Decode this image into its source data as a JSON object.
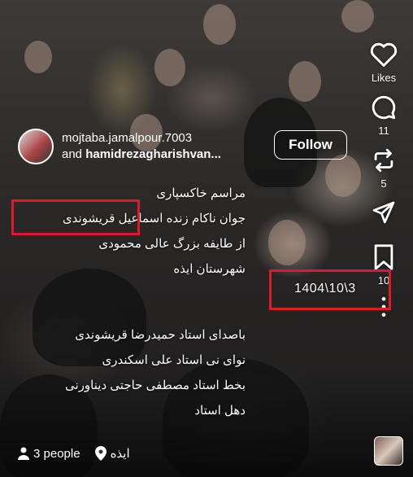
{
  "post": {
    "author1": "mojtaba.jamalpour.7003",
    "and_label": "and",
    "author2": "hamidrezagharishvan...",
    "follow_label": "Follow",
    "caption_lines": [
      "مراسم خاکسپاری",
      "جوان ناکام زنده اسماعیل قریشوندی",
      "از طایفه  بزرگ  عالی محمودی",
      "شهرستان ایذه",
      "باصدای استاد حمیدرضا قریشوندی",
      "نوای نی استاد علی اسکندری",
      "بخط استاد مصطفی حاجتی دیناورنی",
      "دهل استاد"
    ],
    "date_text": "1404\\10\\3",
    "people_label": "3 people",
    "location_label": "ایذه"
  },
  "actions": {
    "likes_label": "Likes",
    "comments_count": "11",
    "reposts_count": "5",
    "saves_count": "10"
  },
  "icons": [
    "heart-icon",
    "comment-icon",
    "repost-icon",
    "share-icon",
    "bookmark-icon",
    "more-icon",
    "person-icon",
    "location-pin-icon"
  ],
  "colors": {
    "highlight": "#e0192a",
    "text": "#ffffff"
  }
}
